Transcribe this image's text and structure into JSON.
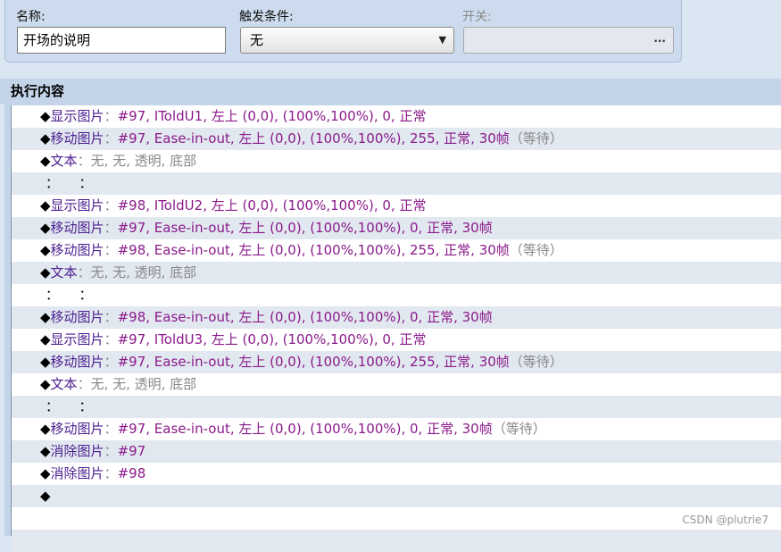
{
  "event": {
    "name_label": "名称:",
    "name_value": "开场的说明",
    "trigger_label": "触发条件:",
    "trigger_value": "无",
    "switch_label": "开关:",
    "switch_button": "..."
  },
  "section": {
    "title": "执行内容"
  },
  "commands": [
    {
      "diamond": "◆",
      "name": "显示图片",
      "sep": "：",
      "params": "#97, IToldU1, 左上 (0,0), (100%,100%), 0, 正常",
      "extra": ""
    },
    {
      "diamond": "◆",
      "name": "移动图片",
      "sep": "：",
      "params": "#97, Ease-in-out, 左上 (0,0), (100%,100%), 255, 正常, 30帧",
      "extra": "（等待）"
    },
    {
      "diamond": "◆",
      "name": "文本",
      "sep": "：",
      "params": "",
      "extra": "无, 无, 透明, 底部"
    },
    {
      "diamond": "",
      "name": "",
      "sep": "：",
      "params": "",
      "extra": "　　：",
      "continuation": true
    },
    {
      "diamond": "◆",
      "name": "显示图片",
      "sep": "：",
      "params": "#98, IToldU2, 左上 (0,0), (100%,100%), 0, 正常",
      "extra": ""
    },
    {
      "diamond": "◆",
      "name": "移动图片",
      "sep": "：",
      "params": "#97, Ease-in-out, 左上 (0,0), (100%,100%), 0, 正常, 30帧",
      "extra": ""
    },
    {
      "diamond": "◆",
      "name": "移动图片",
      "sep": "：",
      "params": "#98, Ease-in-out, 左上 (0,0), (100%,100%), 255, 正常, 30帧",
      "extra": "（等待）"
    },
    {
      "diamond": "◆",
      "name": "文本",
      "sep": "：",
      "params": "",
      "extra": "无, 无, 透明, 底部"
    },
    {
      "diamond": "",
      "name": "",
      "sep": "：",
      "params": "",
      "extra": "　　：",
      "continuation": true
    },
    {
      "diamond": "◆",
      "name": "移动图片",
      "sep": "：",
      "params": "#98, Ease-in-out, 左上 (0,0), (100%,100%), 0, 正常, 30帧",
      "extra": ""
    },
    {
      "diamond": "◆",
      "name": "显示图片",
      "sep": "：",
      "params": "#97, IToldU3, 左上 (0,0), (100%,100%), 0, 正常",
      "extra": ""
    },
    {
      "diamond": "◆",
      "name": "移动图片",
      "sep": "：",
      "params": "#97, Ease-in-out, 左上 (0,0), (100%,100%), 255, 正常, 30帧",
      "extra": "（等待）"
    },
    {
      "diamond": "◆",
      "name": "文本",
      "sep": "：",
      "params": "",
      "extra": "无, 无, 透明, 底部"
    },
    {
      "diamond": "",
      "name": "",
      "sep": "：",
      "params": "",
      "extra": "　　：",
      "continuation": true
    },
    {
      "diamond": "◆",
      "name": "移动图片",
      "sep": "：",
      "params": "#97, Ease-in-out, 左上 (0,0), (100%,100%), 0, 正常, 30帧",
      "extra": "（等待）"
    },
    {
      "diamond": "◆",
      "name": "消除图片",
      "sep": "：",
      "params": "#97",
      "extra": ""
    },
    {
      "diamond": "◆",
      "name": "消除图片",
      "sep": "：",
      "params": "#98",
      "extra": ""
    },
    {
      "diamond": "◆",
      "name": "",
      "sep": "",
      "params": "",
      "extra": ""
    }
  ],
  "watermark": "CSDN @plutrie7"
}
